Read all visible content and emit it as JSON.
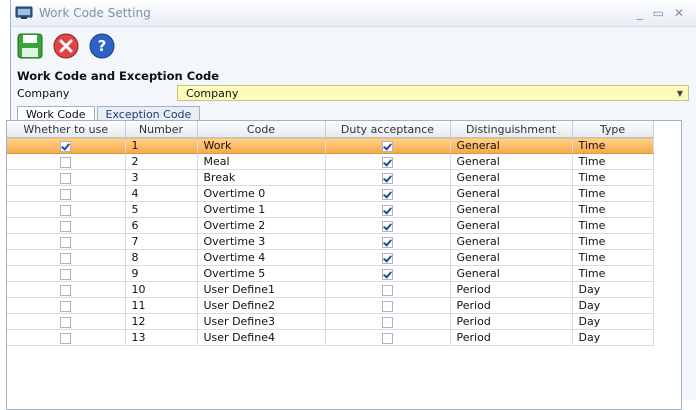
{
  "window": {
    "title": "Work Code Setting"
  },
  "section": {
    "title": "Work Code and Exception Code"
  },
  "company": {
    "label": "Company",
    "value": "Company"
  },
  "tabs": [
    {
      "label": "Work Code",
      "active": true
    },
    {
      "label": "Exception Code",
      "active": false
    }
  ],
  "grid": {
    "columns": [
      "Whether to use",
      "Number",
      "Code",
      "Duty acceptance",
      "Distinguishment",
      "Type"
    ],
    "rows": [
      {
        "use": true,
        "number": "1",
        "code": "Work",
        "duty": true,
        "dist": "General",
        "type": "Time",
        "selected": true
      },
      {
        "use": false,
        "number": "2",
        "code": "Meal",
        "duty": true,
        "dist": "General",
        "type": "Time"
      },
      {
        "use": false,
        "number": "3",
        "code": "Break",
        "duty": true,
        "dist": "General",
        "type": "Time"
      },
      {
        "use": false,
        "number": "4",
        "code": "Overtime 0",
        "duty": true,
        "dist": "General",
        "type": "Time"
      },
      {
        "use": false,
        "number": "5",
        "code": "Overtime 1",
        "duty": true,
        "dist": "General",
        "type": "Time"
      },
      {
        "use": false,
        "number": "6",
        "code": "Overtime 2",
        "duty": true,
        "dist": "General",
        "type": "Time"
      },
      {
        "use": false,
        "number": "7",
        "code": "Overtime 3",
        "duty": true,
        "dist": "General",
        "type": "Time"
      },
      {
        "use": false,
        "number": "8",
        "code": "Overtime 4",
        "duty": true,
        "dist": "General",
        "type": "Time"
      },
      {
        "use": false,
        "number": "9",
        "code": "Overtime 5",
        "duty": true,
        "dist": "General",
        "type": "Time"
      },
      {
        "use": false,
        "number": "10",
        "code": "User Define1",
        "duty": false,
        "dist": "Period",
        "type": "Day"
      },
      {
        "use": false,
        "number": "11",
        "code": "User Define2",
        "duty": false,
        "dist": "Period",
        "type": "Day"
      },
      {
        "use": false,
        "number": "12",
        "code": "User Define3",
        "duty": false,
        "dist": "Period",
        "type": "Day"
      },
      {
        "use": false,
        "number": "13",
        "code": "User Define4",
        "duty": false,
        "dist": "Period",
        "type": "Day"
      }
    ]
  },
  "icons": {
    "save": "save-icon",
    "close": "close-icon",
    "help": "help-icon",
    "app": "app-icon"
  },
  "colors": {
    "selected_row": "#f6a84a",
    "company_field": "#fffbb8"
  }
}
